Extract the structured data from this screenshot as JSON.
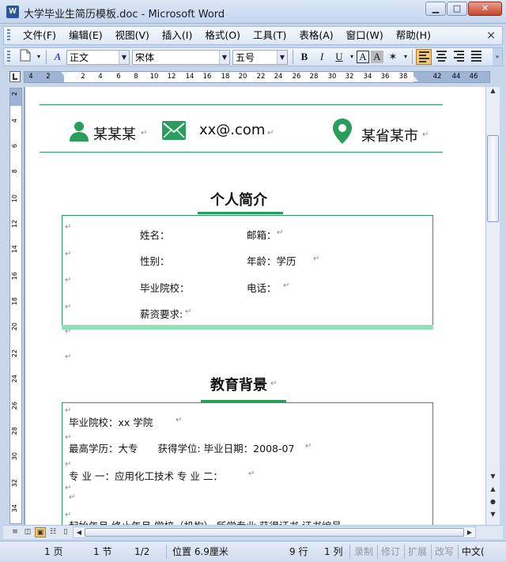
{
  "window": {
    "title": "大学毕业生简历模板.doc - Microsoft Word",
    "minimize": "▁",
    "maximize": "□",
    "close": "✕"
  },
  "menu": {
    "items": [
      "文件(F)",
      "编辑(E)",
      "视图(V)",
      "插入(I)",
      "格式(O)",
      "工具(T)",
      "表格(A)",
      "窗口(W)",
      "帮助(H)"
    ],
    "close": "×"
  },
  "toolbar": {
    "style_value": "正文",
    "font_value": "宋体",
    "size_value": "五号",
    "bold": "B",
    "italic": "I",
    "underline": "U",
    "border_char": "A",
    "shade_char": "A"
  },
  "ruler": {
    "numbers": [
      "4",
      "2",
      "2",
      "4",
      "6",
      "8",
      "10",
      "12",
      "14",
      "16",
      "18",
      "20",
      "22",
      "24",
      "26",
      "28",
      "30",
      "32",
      "34",
      "36",
      "38",
      "42",
      "44",
      "46"
    ],
    "vnumbers": [
      "2",
      "4",
      "6",
      "8",
      "10",
      "12",
      "14",
      "16",
      "18",
      "20",
      "22",
      "24",
      "26",
      "28",
      "30",
      "32",
      "34"
    ]
  },
  "document": {
    "contact": {
      "name": "某某某",
      "email": "xx@.com",
      "location": "某省某市"
    },
    "section1_title": "个人简介",
    "personal": {
      "name": "姓名：",
      "email": "邮箱：",
      "gender": "性别：",
      "age": "年龄：学历",
      "school": "毕业院校：",
      "phone": "电话：",
      "salary": "薪资要求:"
    },
    "section2_title": "教育背景",
    "education": {
      "line1": "毕业院校：xx 学院",
      "line2": "最高学历：大专　　获得学位: 毕业日期：2008-07",
      "line3": "专  业  一：应用化工技术   专  业  二：",
      "line4": "起始年月    终止年月    学校（机构）   所学专业    获得证书    证书编号"
    },
    "para_mark": "↵"
  },
  "statusbar": {
    "page": "1 页",
    "section": "1 节",
    "page_of": "1/2",
    "position": "位置 6.9厘米",
    "line": "9 行",
    "column": "1 列",
    "rec": "录制",
    "trk": "修订",
    "ext": "扩展",
    "ovr": "改写",
    "lang": "中文("
  },
  "colors": {
    "accent_green": "#2a9d5c",
    "box_bottom": "#8fe0b5"
  }
}
